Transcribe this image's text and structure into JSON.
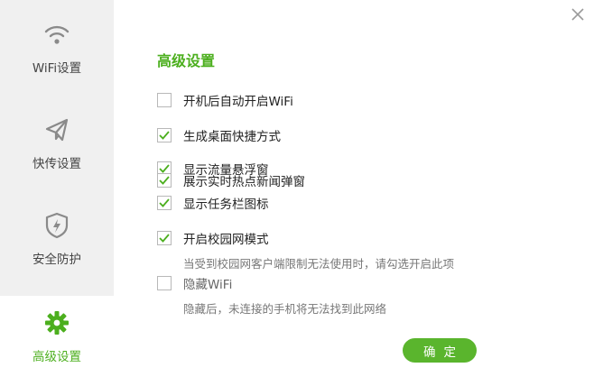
{
  "sidebar": {
    "items": [
      {
        "label": "WiFi设置",
        "icon": "wifi-icon",
        "active": false
      },
      {
        "label": "快传设置",
        "icon": "paper-plane-icon",
        "active": false
      },
      {
        "label": "安全防护",
        "icon": "shield-icon",
        "active": false
      },
      {
        "label": "高级设置",
        "icon": "gear-icon",
        "active": true
      }
    ]
  },
  "main": {
    "title": "高级设置",
    "options": [
      {
        "label": "开机后自动开启WiFi",
        "checked": false
      },
      {
        "label": "生成桌面快捷方式",
        "checked": true
      },
      {
        "label": "显示流量悬浮窗",
        "checked": true
      },
      {
        "label": "展示实时热点新闻弹窗",
        "checked": true
      },
      {
        "label": "显示任务栏图标",
        "checked": true
      },
      {
        "label": "开启校园网模式",
        "checked": true,
        "hint": "当受到校园网客户端限制无法使用时，请勾选开启此项"
      },
      {
        "label": "隐藏WiFi",
        "checked": false,
        "hint": "隐藏后，未连接的手机将无法找到此网络"
      }
    ],
    "confirm_label": "确定"
  },
  "colors": {
    "accent": "#5ab52d",
    "active_text": "#4caf1e",
    "sidebar_bg": "#f0f0f0"
  }
}
